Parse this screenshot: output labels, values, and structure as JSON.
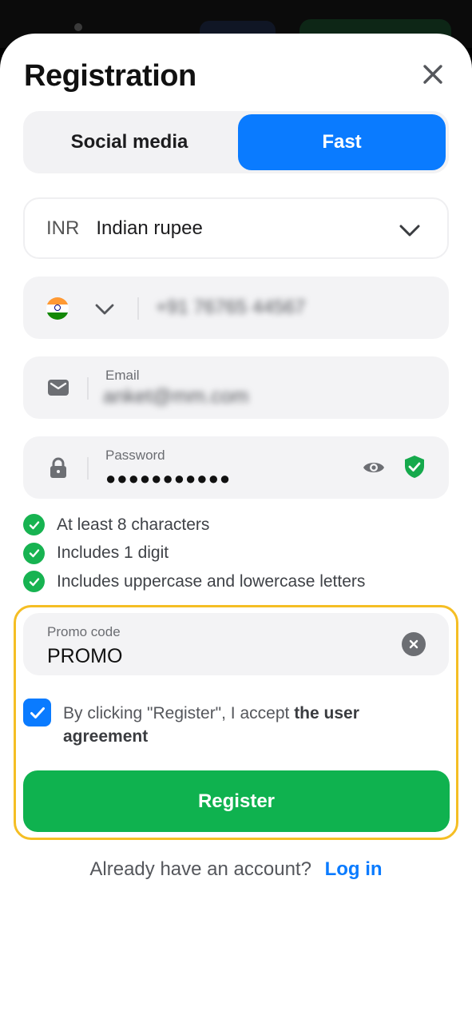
{
  "sheet": {
    "title": "Registration"
  },
  "tabs": [
    {
      "label": "Social media",
      "active": false
    },
    {
      "label": "Fast",
      "active": true
    }
  ],
  "currency": {
    "code": "INR",
    "name": "Indian rupee"
  },
  "phone": {
    "value": "+91 76765 44567"
  },
  "email": {
    "label": "Email",
    "value": "anket@mm.com"
  },
  "password": {
    "label": "Password",
    "value": "●●●●●●●●●●●"
  },
  "rules": [
    "At least 8 characters",
    "Includes 1 digit",
    "Includes uppercase and lowercase letters"
  ],
  "promo": {
    "label": "Promo code",
    "value": "PROMO"
  },
  "agreement": {
    "text": "By clicking \"Register\", I accept ",
    "link": "the user agreement",
    "checked": true
  },
  "register_label": "Register",
  "login": {
    "question": "Already have an account?",
    "link": "Log in"
  },
  "colors": {
    "accent": "#0a7bff",
    "success": "#0fb24f",
    "highlight": "#f5be24"
  },
  "icons": [
    "close-icon",
    "chevron-down-icon",
    "india-flag-icon",
    "envelope-icon",
    "lock-icon",
    "eye-icon",
    "shield-check-icon",
    "check-circle-icon",
    "clear-icon",
    "checkbox-check-icon"
  ]
}
